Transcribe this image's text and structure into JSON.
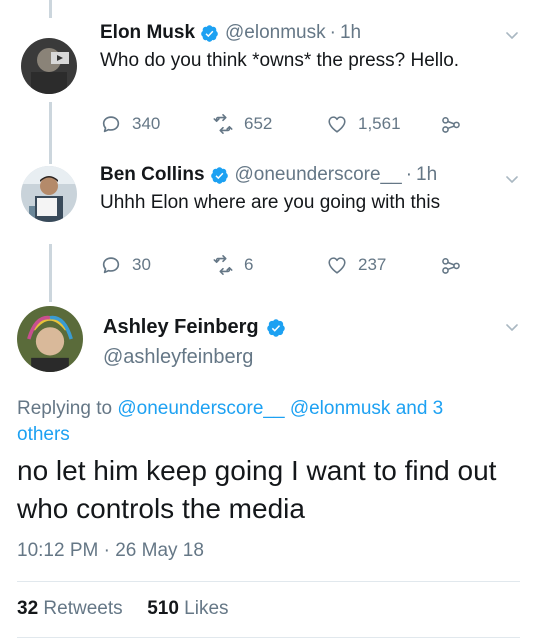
{
  "thread": [
    {
      "display_name": "Elon Musk",
      "handle": "@elonmusk",
      "separator": "·",
      "time": "1h",
      "text": "Who do you think *owns* the press? Hello.",
      "replies": "340",
      "retweets": "652",
      "likes": "1,561"
    },
    {
      "display_name": "Ben Collins",
      "handle": "@oneunderscore__",
      "separator": "·",
      "time": "1h",
      "text": "Uhhh Elon where are you going with this",
      "replies": "30",
      "retweets": "6",
      "likes": "237"
    }
  ],
  "main_tweet": {
    "display_name": "Ashley Feinberg",
    "handle": "@ashleyfeinberg",
    "replying_prefix": "Replying to ",
    "replying_mention_1": "@oneunderscore__",
    "replying_mention_2": "@elonmusk",
    "replying_others": "and 3 others",
    "text": "no let him keep going I want to find out who controls the media",
    "timestamp": "10:12 PM · 26 May 18",
    "retweets_count": "32",
    "retweets_label": "Retweets",
    "likes_count": "510",
    "likes_label": "Likes"
  },
  "colors": {
    "accent": "#1da1f2",
    "muted": "#657786",
    "text": "#14171a",
    "line": "#ccd6dd"
  },
  "icons": [
    "reply-icon",
    "retweet-icon",
    "like-icon",
    "share-icon",
    "verified-icon",
    "caret-down-icon"
  ]
}
